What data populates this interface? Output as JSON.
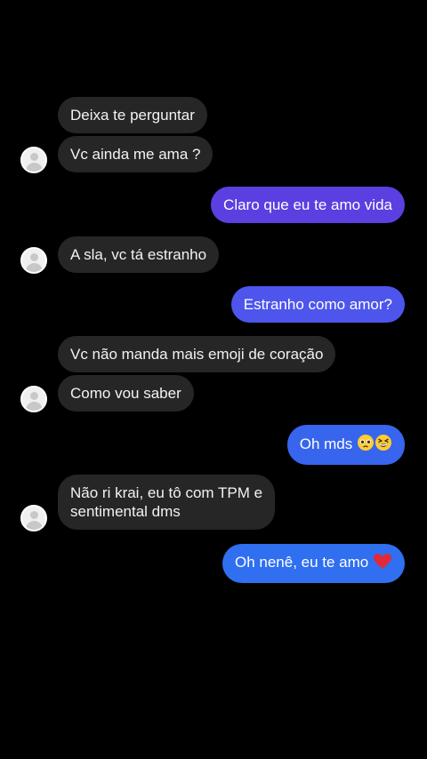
{
  "messages": [
    {
      "text": "Deixa te perguntar"
    },
    {
      "text": "Vc ainda me ama ?"
    },
    {
      "text": "Claro que eu te amo vida"
    },
    {
      "text": "A sla, vc tá estranho"
    },
    {
      "text": "Estranho como amor?"
    },
    {
      "text": "Vc não manda mais emoji de coração"
    },
    {
      "text": "Como vou saber"
    },
    {
      "text": "Oh mds",
      "emoji": [
        "pleading-face-emoji",
        "grinning-squinting-face-emoji"
      ]
    },
    {
      "line1": "Não ri krai, eu tô com TPM e",
      "line2": "sentimental dms"
    },
    {
      "text": "Oh nenê, eu te amo",
      "emoji": [
        "red-heart-emoji"
      ]
    }
  ],
  "colors": {
    "background": "#000000",
    "incoming_bubble": "#262626",
    "outgoing_purple": "#5b3fe0",
    "outgoing_indigo": "#4d55ec",
    "outgoing_blue": "#2f6ff0",
    "heart": "#e02a3a"
  }
}
